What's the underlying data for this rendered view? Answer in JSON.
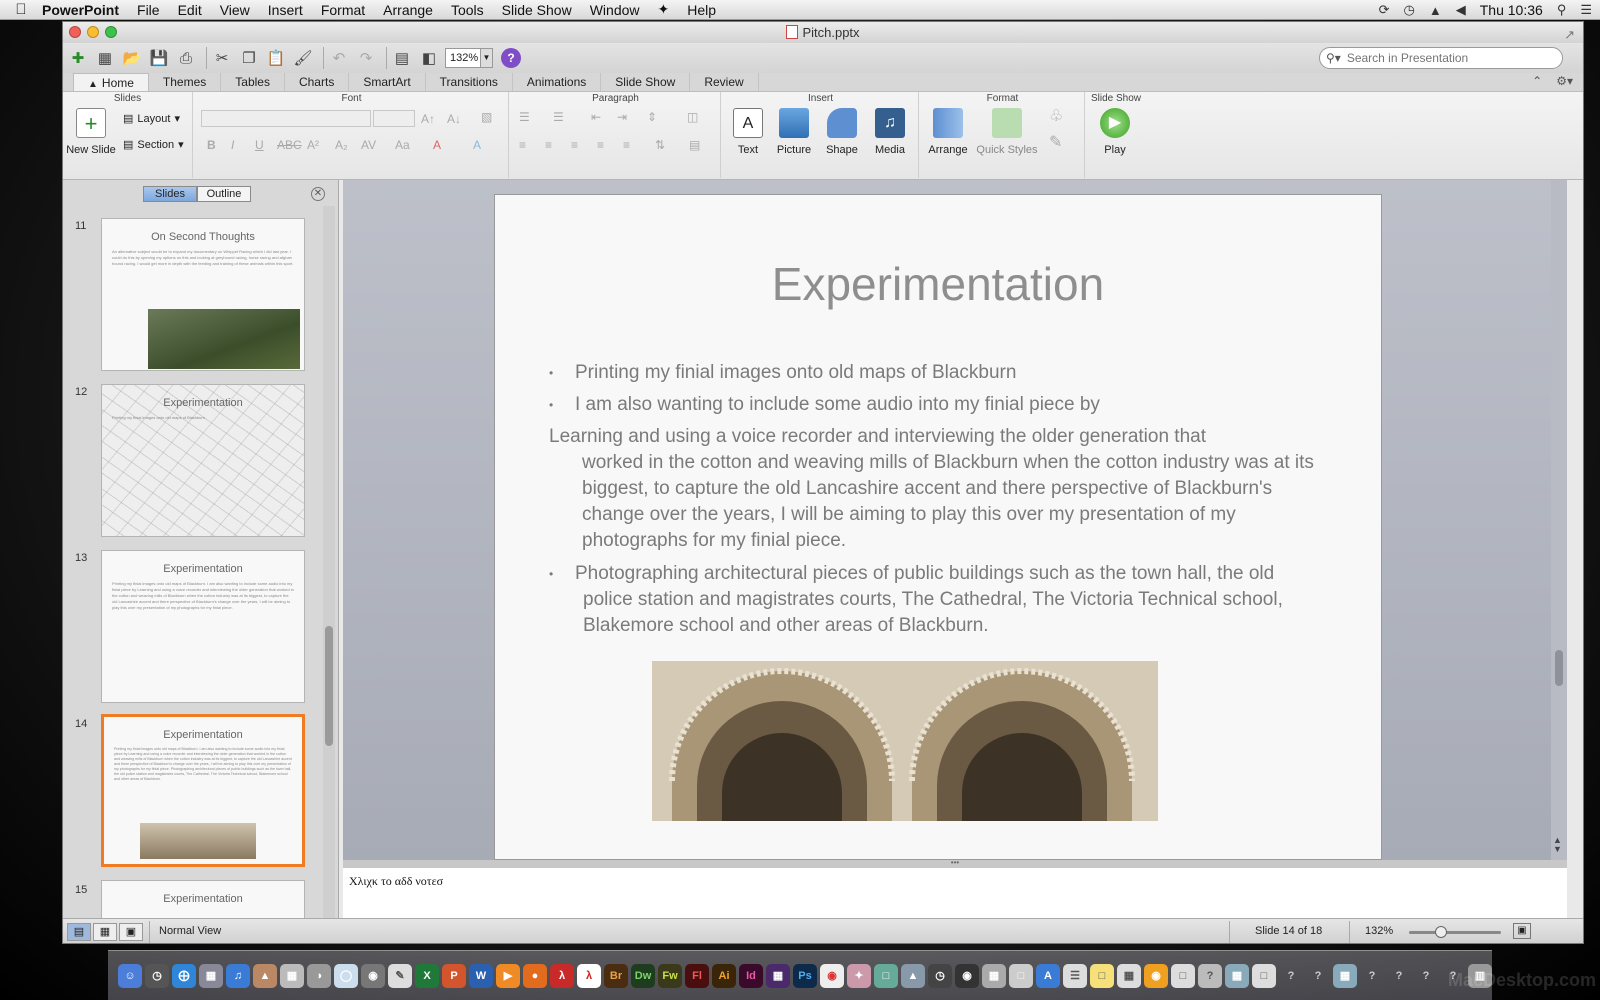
{
  "menubar": {
    "app_name": "PowerPoint",
    "items": [
      "File",
      "Edit",
      "View",
      "Insert",
      "Format",
      "Arrange",
      "Tools",
      "Slide Show",
      "Window",
      "Help"
    ],
    "clock": "Thu 10:36"
  },
  "window": {
    "title": "Pitch.pptx"
  },
  "toolbar": {
    "zoom": "132%",
    "search_placeholder": "Search in Presentation"
  },
  "ribbon_tabs": [
    "Home",
    "Themes",
    "Tables",
    "Charts",
    "SmartArt",
    "Transitions",
    "Animations",
    "Slide Show",
    "Review"
  ],
  "ribbon": {
    "groups": {
      "slides": "Slides",
      "font": "Font",
      "paragraph": "Paragraph",
      "insert": "Insert",
      "format": "Format",
      "slideshow": "Slide Show"
    },
    "new_slide": "New Slide",
    "layout": "Layout",
    "section": "Section",
    "text": "Text",
    "picture": "Picture",
    "shape": "Shape",
    "media": "Media",
    "arrange": "Arrange",
    "quick_styles": "Quick Styles",
    "play": "Play"
  },
  "left_pane": {
    "tabs": {
      "slides": "Slides",
      "outline": "Outline"
    },
    "thumbnails": [
      {
        "num": "11",
        "title": "On Second Thoughts",
        "body": "An alternative subject would be to expand my documentary on Whippet Racing which I did last year. I could do this by opening my options on this and looking at greyhound racing, horse racing and afghan hound racing. I would get more in depth with the feeding and training of these animals within this sport."
      },
      {
        "num": "12",
        "title": "Experimentation",
        "body": "Printing my finial images onto old maps of Blackburn"
      },
      {
        "num": "13",
        "title": "Experimentation",
        "body": "Printing my finial images onto old maps of Blackburn. I am also wanting to include some audio into my finial piece by Learning and using a voice recorder and interviewing the older generation that worked in the cotton and weaving mills of Blackburn when the cotton industry was at its biggest, to capture the old Lancashire accent and there perspective of Blackburn's change over the years, I will be aiming to play this over my presentation of my photographs for my finial piece."
      },
      {
        "num": "14",
        "title": "Experimentation",
        "body": "Printing my finial images onto old maps of Blackburn. I am also wanting to include some audio into my finial piece by Learning and using a voice recorder and interviewing the older generation that worked in the cotton and weaving mills of Blackburn when the cotton industry was at its biggest, to capture the old Lancashire accent and there perspective of Blackburn's change over the years, I will be aiming to play this over my presentation of my photographs for my finial piece. Photographing architectural pieces of public buildings such as the town hall, the old police station and magistrates courts, The Cathedral, The Victoria Technical school, Blakemore school and other areas of Blackburn."
      },
      {
        "num": "15",
        "title": "Experimentation",
        "body": ""
      }
    ]
  },
  "slide": {
    "title": "Experimentation",
    "bullet1": "Printing my finial images onto old maps of Blackburn",
    "bullet2": "I am also wanting to include some audio into my finial piece by",
    "para_line1": "Learning and using a voice recorder and interviewing the older generation that",
    "para_rest": "worked in the cotton and weaving mills of Blackburn when the cotton industry was at its biggest, to capture the old Lancashire accent and there perspective of Blackburn's change over the years, I will be aiming to play this over my presentation of my photographs for my finial piece.",
    "bullet3_line1": "Photographing architectural pieces of public buildings such as the town hall, the old",
    "bullet3_rest": "police station and magistrates courts, The Cathedral, The Victoria Technical school, Blakemore school and other areas of Blackburn.",
    "bullet_char": "•"
  },
  "notes": {
    "placeholder": "Χλιχκ το αδδ νοτεσ"
  },
  "status": {
    "view": "Normal View",
    "slide_count": "Slide 14 of 18",
    "zoom": "132%"
  },
  "watermark": "MacDesktop.com"
}
